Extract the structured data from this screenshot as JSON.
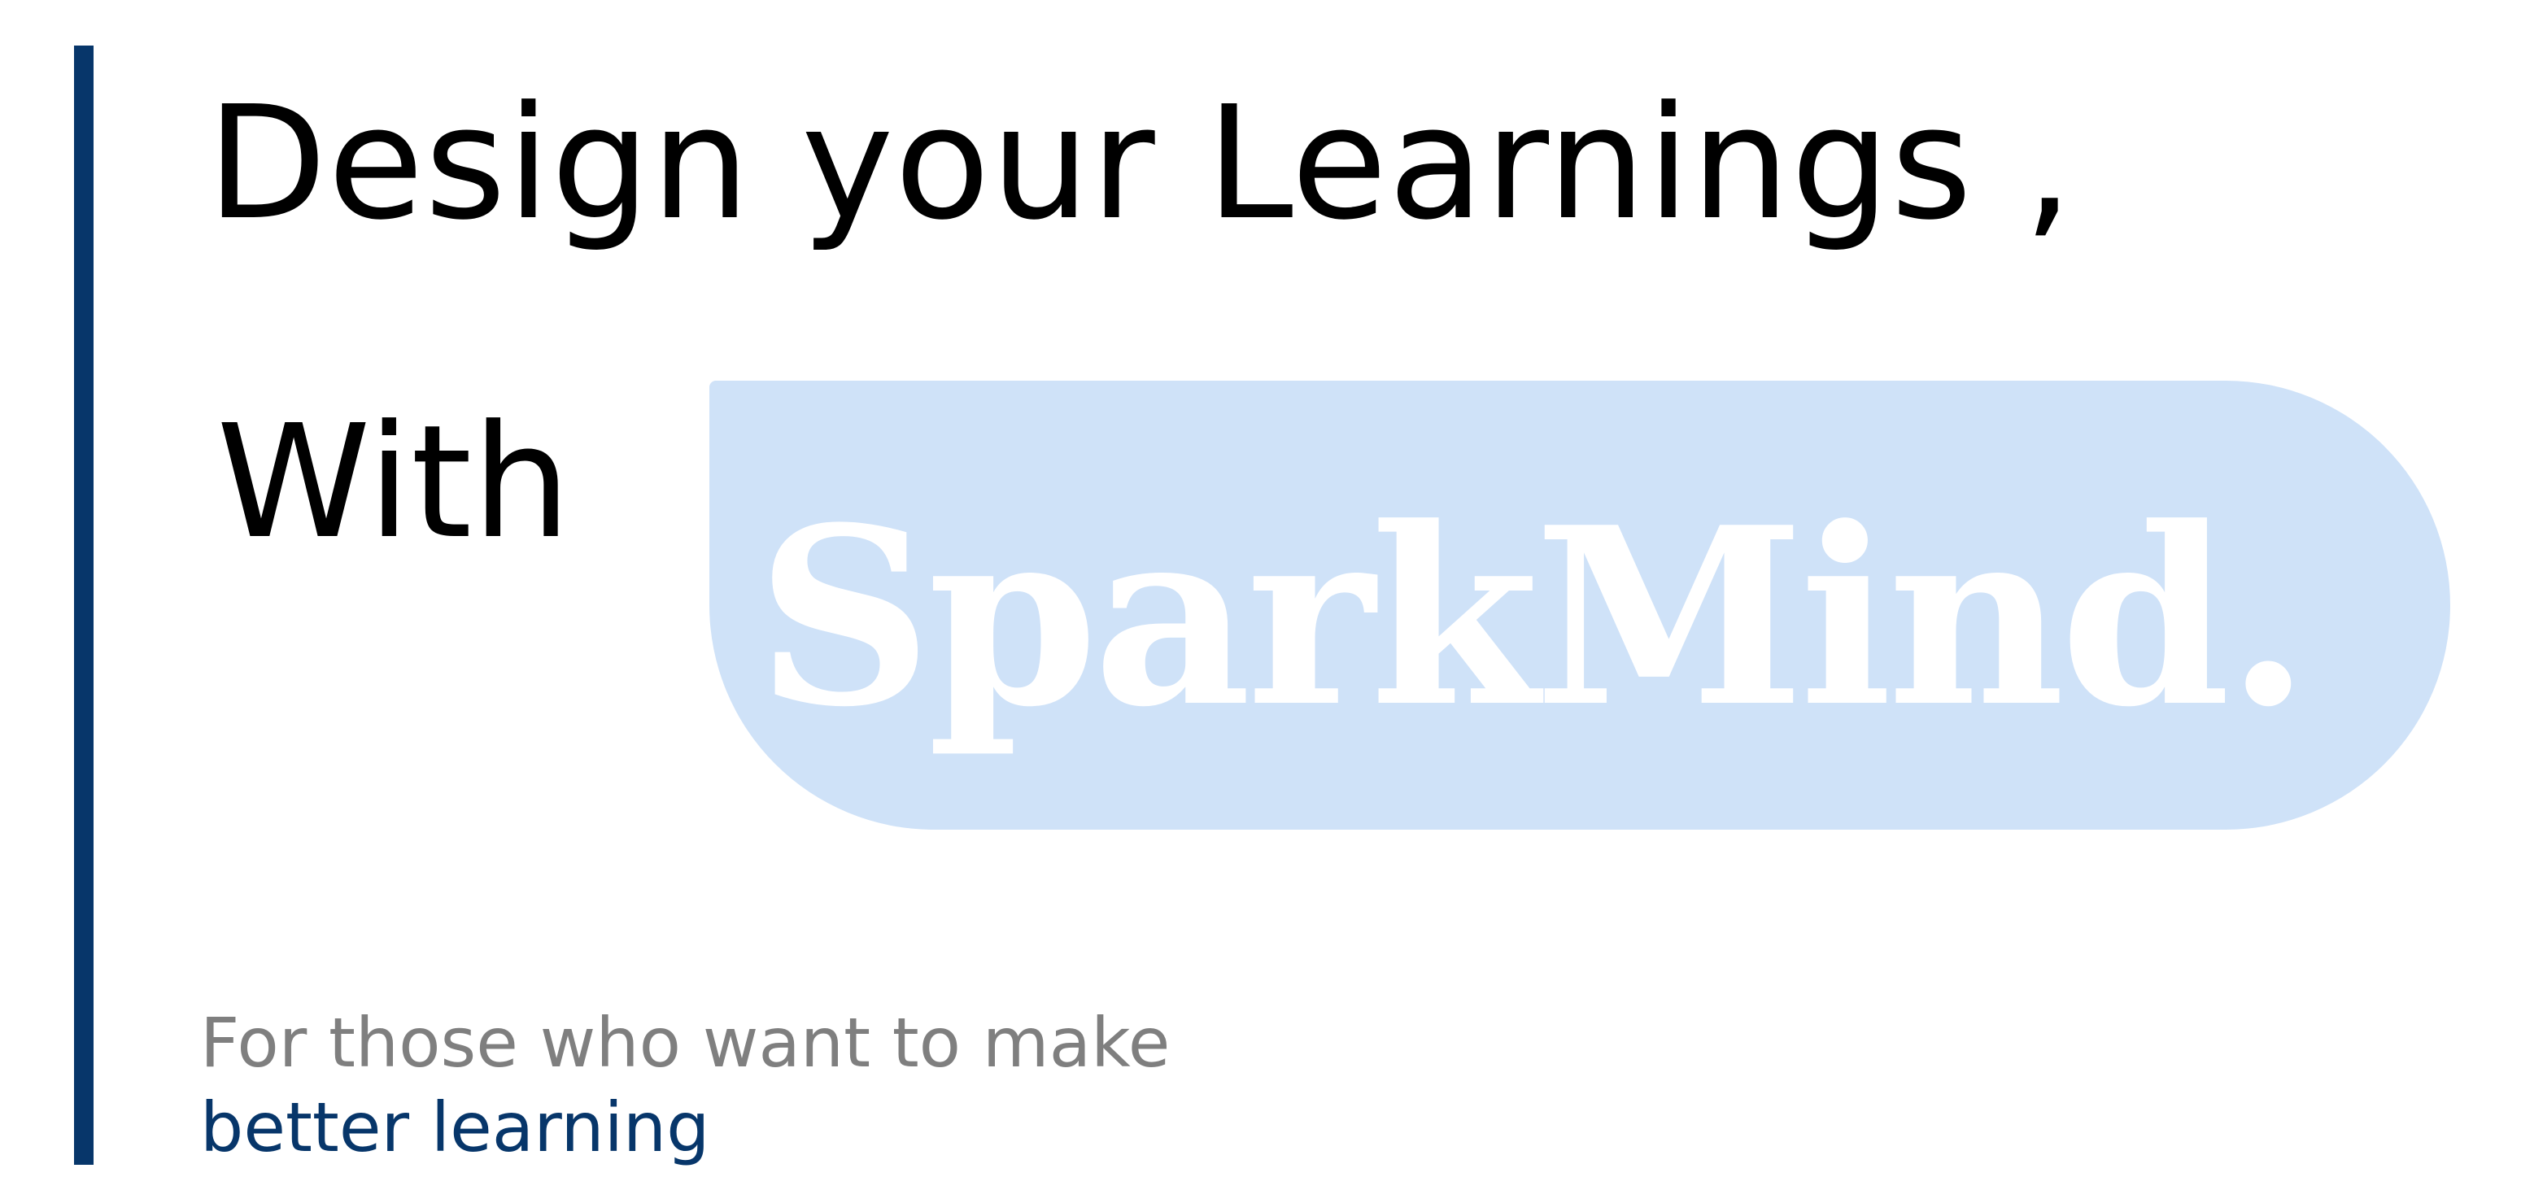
{
  "headline": {
    "line1": "Design your Learnings ,",
    "line2": "With"
  },
  "brand": {
    "name": "SparkMind."
  },
  "tagline": {
    "line1": "For those who want to make",
    "line2": "better learning"
  },
  "colors": {
    "accent": "#07366a",
    "pill_background": "#cfe2f8",
    "brand_text": "#ffffff",
    "tagline_muted": "#7f7f7f",
    "headline_text": "#000000"
  }
}
